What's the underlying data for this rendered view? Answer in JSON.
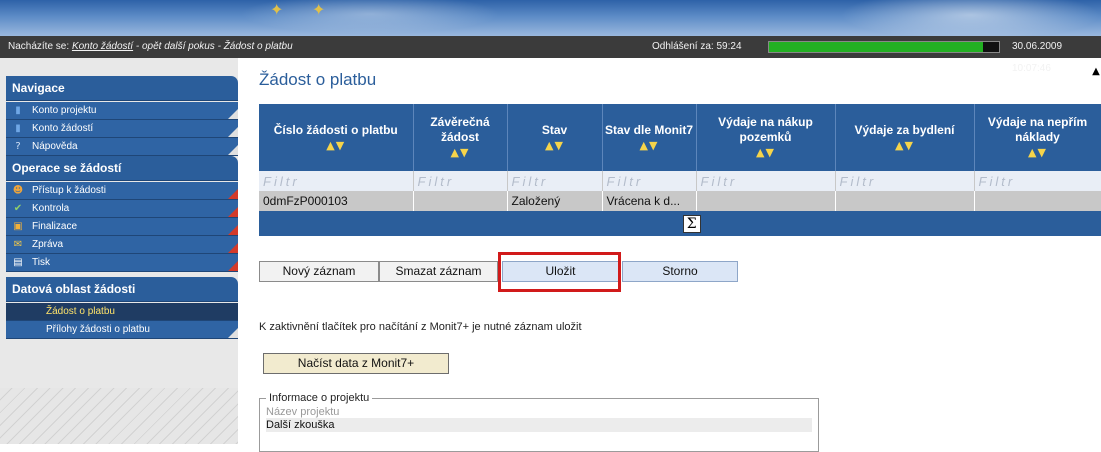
{
  "statusbar": {
    "location_prefix": "Nacházíte se:",
    "crumb_link": "Konto žádostí",
    "crumb_rest": "- opět další pokus - Žádost o platbu",
    "logout_label": "Odhlášení za: 59:24",
    "session_progress": 0.93,
    "datetime": "30.06.2009 10:07:46"
  },
  "sidebar": {
    "sections": [
      {
        "title": "Navigace",
        "items": [
          {
            "label": "Konto projektu",
            "icon": "book-icon"
          },
          {
            "label": "Konto žádostí",
            "icon": "book-icon"
          },
          {
            "label": "Nápověda",
            "icon": "help-icon"
          }
        ]
      },
      {
        "title": "Operace se žádostí",
        "items": [
          {
            "label": "Přístup k žádosti",
            "icon": "users-icon"
          },
          {
            "label": "Kontrola",
            "icon": "check-icon"
          },
          {
            "label": "Finalizace",
            "icon": "lock-icon"
          },
          {
            "label": "Zpráva",
            "icon": "mail-icon"
          },
          {
            "label": "Tisk",
            "icon": "document-icon"
          }
        ]
      },
      {
        "title": "Datová oblast žádosti",
        "items": [
          {
            "label": "Žádost o platbu"
          },
          {
            "label": "Přílohy žádosti o platbu"
          }
        ]
      }
    ]
  },
  "main": {
    "title": "Žádost o platbu",
    "columns": [
      {
        "label": "Číslo žádosti o platbu",
        "sort": "▲▼"
      },
      {
        "label": "Závěrečná žádost",
        "sort": "▲▼"
      },
      {
        "label": "Stav",
        "sort": "▲▼"
      },
      {
        "label": "Stav dle Monit7",
        "sort": "▲▼"
      },
      {
        "label": "Výdaje na nákup pozemků",
        "sort": "▲▼"
      },
      {
        "label": "Výdaje za bydlení",
        "sort": "▲▼"
      },
      {
        "label": "Výdaje na nepřím náklady",
        "sort": "▲▼"
      }
    ],
    "filter_placeholder": "Filtr",
    "rows": [
      [
        "0dmFzP000103",
        "",
        "Založený",
        "Vrácena k d...",
        "",
        "",
        ""
      ]
    ],
    "sum_symbol": "Σ",
    "buttons": {
      "new": "Nový záznam",
      "delete": "Smazat záznam",
      "save": "Uložit",
      "cancel": "Storno"
    },
    "info_text": "K zaktivnění tlačítek pro načítání z Monit7+ je nutné záznam uložit",
    "load_button": "Načíst data z Monit7+",
    "project_info": {
      "legend": "Informace o projektu",
      "name_label": "Název projektu",
      "name_value": "Další zkouška"
    }
  }
}
